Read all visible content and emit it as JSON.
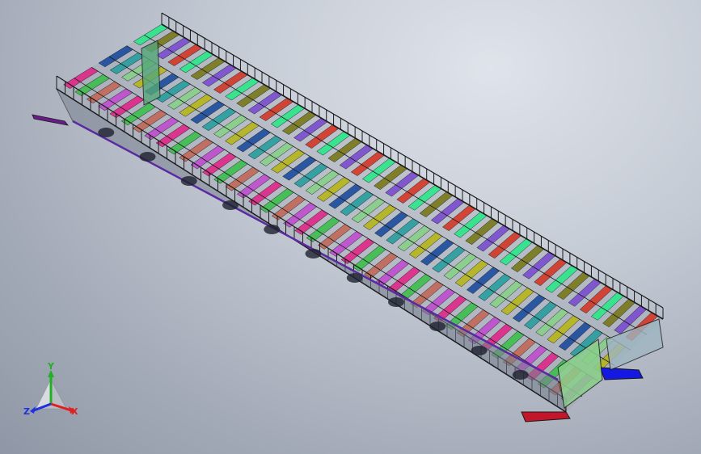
{
  "viewport": {
    "background_top": "#dfe3ea",
    "background_bottom": "#8f97a6"
  },
  "model": {
    "frame_color": "#1a1a1a",
    "part_colors": [
      "#2ee68a",
      "#3fbf4f",
      "#b6b61e",
      "#7a7a1e",
      "#c26a5a",
      "#1f4f9f",
      "#7b4fd0",
      "#c04fd0",
      "#2a9fa0",
      "#d33a2a",
      "#e02a8a",
      "#89d08a"
    ],
    "end_plate_left_color": "#c4162a",
    "end_plate_right_color": "#1418e0",
    "end_plate_left_color_2": "#6b1a8a"
  },
  "triad": {
    "icon": "coordinate-triad-icon",
    "x_label": "X",
    "y_label": "Y",
    "z_label": "Z",
    "x_color": "#e02020",
    "y_color": "#20b020",
    "z_color": "#2030e0"
  }
}
